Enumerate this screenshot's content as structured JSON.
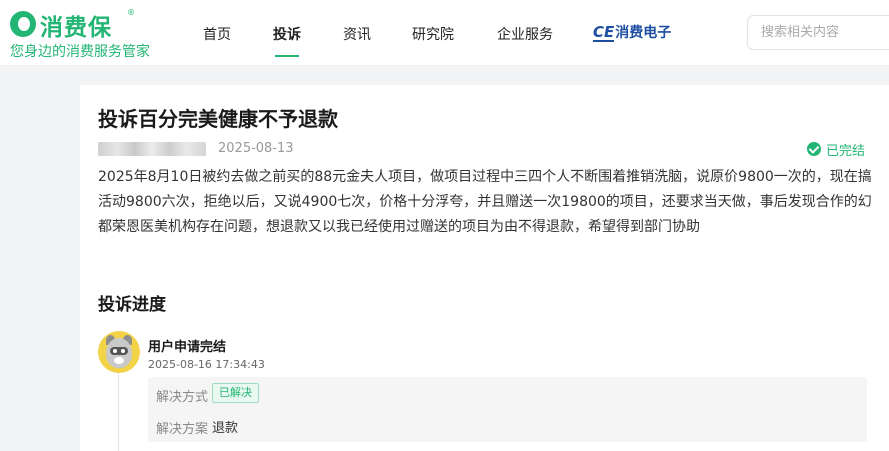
{
  "brand": {
    "name": "消费保",
    "reg": "®",
    "slogan": "您身边的消费服务管家",
    "accent": "#22b573"
  },
  "nav": {
    "items": [
      {
        "label": "首页",
        "active": false
      },
      {
        "label": "投诉",
        "active": true
      },
      {
        "label": "资讯",
        "active": false
      },
      {
        "label": "研究院",
        "active": false
      },
      {
        "label": "企业服务",
        "active": false
      }
    ],
    "partner": {
      "mark": "CE",
      "text": "消费电子"
    }
  },
  "search": {
    "placeholder": "搜索相关内容",
    "value": ""
  },
  "complaint": {
    "title": "投诉百分完美健康不予退款",
    "date": "2025-08-13",
    "status": "已完结",
    "description": "2025年8月10日被约去做之前买的88元金夫人项目，做项目过程中三四个人不断围着推销洗脑，说原价9800一次的，现在搞活动9800六次，拒绝以后，又说4900七次，价格十分浮夸，并且赠送一次19800的项目，还要求当天做，事后发现合作的幻都荣恩医美机构存在问题，想退款又以我已经使用过赠送的项目为由不得退款，希望得到部门协助"
  },
  "progress": {
    "section_title": "投诉进度",
    "events": [
      {
        "avatar_icon": "raccoon-avatar-icon",
        "title": "用户申请完结",
        "time": "2025-08-16 17:34:43",
        "resolution_label": "解决方式",
        "resolution_tag": "已解决",
        "plan_label": "解决方案",
        "plan_value": "退款"
      }
    ]
  }
}
